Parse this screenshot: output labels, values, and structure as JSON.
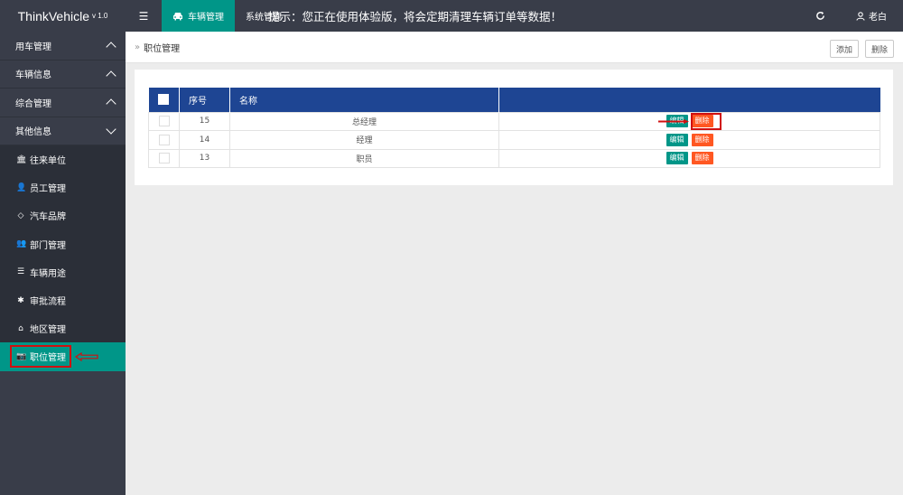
{
  "app": {
    "name": "ThinkVehicle",
    "version": "v 1.0"
  },
  "topbar": {
    "menu_icon": "menu-icon",
    "active_tab": {
      "icon": "car-icon",
      "label": "车辆管理"
    },
    "sys_tab": "系统管理",
    "notice": "提示：您正在使用体验版，将会定期清理车辆订单等数据！",
    "refresh_icon": "refresh-icon",
    "user": {
      "icon": "user-icon",
      "name": "老白"
    }
  },
  "sidebar": {
    "groups": [
      {
        "label": "用车管理",
        "expanded": false
      },
      {
        "label": "车辆信息",
        "expanded": false
      },
      {
        "label": "综合管理",
        "expanded": false
      },
      {
        "label": "其他信息",
        "expanded": true
      }
    ],
    "items": [
      {
        "icon": "bank-icon",
        "label": "往来单位"
      },
      {
        "icon": "user-icon",
        "label": "员工管理"
      },
      {
        "icon": "diamond-icon",
        "label": "汽车品牌"
      },
      {
        "icon": "group-icon",
        "label": "部门管理"
      },
      {
        "icon": "list-icon",
        "label": "车辆用途"
      },
      {
        "icon": "flow-icon",
        "label": "审批流程"
      },
      {
        "icon": "home-icon",
        "label": "地区管理"
      },
      {
        "icon": "camera-icon",
        "label": "职位管理",
        "active": true
      }
    ]
  },
  "breadcrumb": {
    "separator": "»",
    "current": "职位管理"
  },
  "toolbar": {
    "add_label": "添加",
    "delete_label": "删除"
  },
  "table": {
    "headers": [
      "序号",
      "名称"
    ],
    "rows": [
      {
        "id": "15",
        "name": "总经理"
      },
      {
        "id": "14",
        "name": "经理"
      },
      {
        "id": "13",
        "name": "职员"
      }
    ],
    "edit_label": "编辑",
    "delete_label": "删除"
  },
  "colors": {
    "topbar": "#393d49",
    "accent": "#009688",
    "table_header": "#1e4593",
    "danger": "#ff5722",
    "annotation": "#d01010"
  }
}
